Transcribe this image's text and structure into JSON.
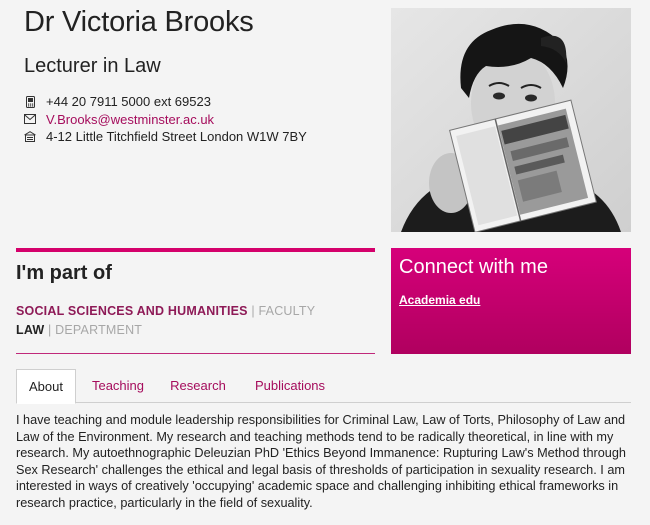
{
  "profile": {
    "name": "Dr Victoria Brooks",
    "role": "Lecturer in Law",
    "phone": "+44 20 7911 5000 ext 69523",
    "email": "V.Brooks@westminster.ac.uk",
    "address": "4-12 Little Titchfield Street London W1W 7BY",
    "phone_icon": "phone-icon",
    "email_icon": "envelope-icon",
    "address_icon": "building-icon"
  },
  "part_of": {
    "title": "I'm part of",
    "faculty_name": "SOCIAL SCIENCES AND HUMANITIES",
    "faculty_label": " | FACULTY",
    "department_name": "LAW",
    "department_label": " | DEPARTMENT"
  },
  "connect": {
    "title": "Connect with me",
    "link": "Academia edu"
  },
  "tabs": [
    {
      "label": "About",
      "active": true
    },
    {
      "label": "Teaching",
      "active": false
    },
    {
      "label": "Research",
      "active": false
    },
    {
      "label": "Publications",
      "active": false
    }
  ],
  "about": {
    "text": "I have teaching and module leadership responsibilities for Criminal Law, Law of Torts, Philosophy of Law and Law of the Environment. My research and teaching methods tend to be radically theoretical, in line with my research. My autoethnographic Deleuzian PhD 'Ethics Beyond Immanence: Rupturing Law's Method through Sex Research' challenges the ethical and legal basis of thresholds of participation in sexuality research. I am interested in ways of creatively 'occupying' academic space and challenging inhibiting ethical frameworks in research practice, particularly in the field of sexuality."
  },
  "colors": {
    "accent": "#d4006b",
    "link": "#a50c5c"
  }
}
